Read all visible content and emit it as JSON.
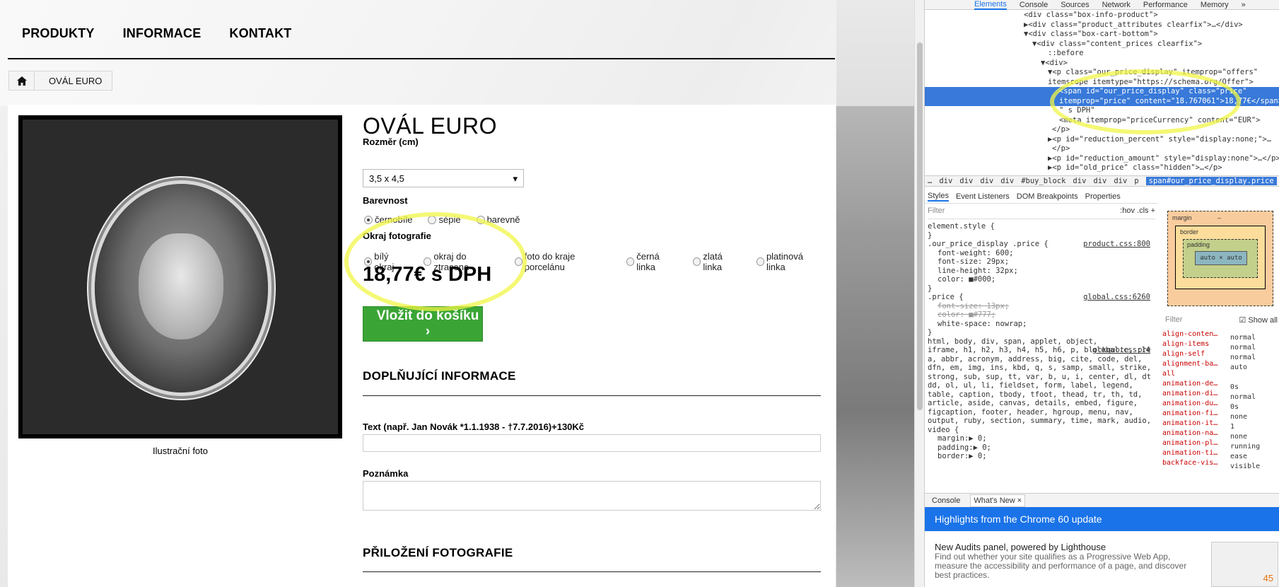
{
  "nav": {
    "items": [
      "PRODUKTY",
      "INFORMACE",
      "KONTAKT"
    ]
  },
  "breadcrumb": {
    "current": "OVÁL EURO"
  },
  "product": {
    "title": "OVÁL EURO",
    "caption": "Ilustrační foto",
    "size_label": "Rozměr (cm)",
    "size_value": "3,5 x 4,5",
    "color_label": "Barevnost",
    "color_options": [
      "černobíle",
      "sépie",
      "barevně"
    ],
    "edge_label": "Okraj fotografie",
    "edge_options": [
      "bílý okraj",
      "okraj do ztracena",
      "foto do kraje porcelánu",
      "černá linka",
      "zlatá linka",
      "platinová linka"
    ],
    "price": "18,77€ s DPH",
    "cart_button": "Vložit do košíku ›",
    "section_additional": "DOPLŇUJÍCÍ INFORMACE",
    "text_label": "Text (např. Jan Novák *1.1.1938 - †7.7.2016)+130Kč",
    "note_label": "Poznámka",
    "section_photo": "PŘILOŽENÍ FOTOGRAFIE"
  },
  "devtools": {
    "tabs": [
      "Elements",
      "Console",
      "Sources",
      "Network",
      "Performance",
      "Memory",
      "»"
    ],
    "tree": [
      "<div class=\"box-info-product\">",
      "▶<div class=\"product_attributes clearfix\">…</div>",
      "▼<div class=\"box-cart-bottom\">",
      "▼<div class=\"content_prices clearfix\">",
      "::before",
      "▼<div>",
      "▼<p class=\"our_price_display\" itemprop=\"offers\"",
      "itemscope itemtype=\"https://schema.org/Offer\">",
      "<span id=\"our_price_display\" class=\"price\"",
      "itemprop=\"price\" content=\"18.767061\">18,77€</span>",
      "\" s DPH\"",
      "<meta itemprop=\"priceCurrency\" content=\"EUR\">",
      "</p>",
      "▶<p id=\"reduction_percent\" style=\"display:none;\">…",
      "</p>",
      "▶<p id=\"reduction_amount\" style=\"display:none\">…</p>",
      "▶<p id=\"old_price\" class=\"hidden\">…</p>"
    ],
    "breadcrumb": [
      "…",
      "div",
      "div",
      "div",
      "div",
      "#buy_block",
      "div",
      "div",
      "div",
      "p"
    ],
    "breadcrumb_selected": "span#our_price_display.price",
    "style_tabs": [
      "Styles",
      "Event Listeners",
      "DOM Breakpoints",
      "Properties"
    ],
    "filter": "Filter",
    "filter_right": ":hov  .cls  +",
    "rules": [
      "element.style {",
      "}",
      ".our_price_display .price {",
      "font-weight: 600;",
      "font-size: 29px;",
      "line-height: 32px;",
      "color: ■#000;",
      "}",
      ".price {",
      "font-size: 13px;",
      "color: ■#777;",
      "white-space: nowrap;",
      "}",
      "html, body, div, span, applet, object,",
      "iframe, h1, h2, h3, h4, h5, h6, p, blockquote, pre,",
      "a, abbr, acronym, address, big, cite, code, del,",
      "dfn, em, img, ins, kbd, q, s, samp, small, strike,",
      "strong, sub, sup, tt, var, b, u, i, center, dl, dt,",
      "dd, ol, ul, li, fieldset, form, label, legend,",
      "table, caption, tbody, tfoot, thead, tr, th, td,",
      "article, aside, canvas, details, embed, figure,",
      "figcaption, footer, header, hgroup, menu, nav,",
      "output, ruby, section, summary, time, mark, audio,",
      "video {",
      "margin:▶ 0;",
      "padding:▶ 0;",
      "border:▶ 0;"
    ],
    "sources": [
      "product.css:800",
      "global.css:6260",
      "global.css:14"
    ],
    "box_model": {
      "margin": "margin",
      "border": "border",
      "padding": "padding",
      "content": "auto × auto",
      "dash": "–"
    },
    "computed_filter": "Filter",
    "show_all": "Show all",
    "computed": [
      [
        "align-conten…",
        "normal"
      ],
      [
        "align-items",
        "normal"
      ],
      [
        "align-self",
        "normal"
      ],
      [
        "alignment-ba…",
        "auto"
      ],
      [
        "all",
        ""
      ],
      [
        "animation-de…",
        "0s"
      ],
      [
        "animation-di…",
        "normal"
      ],
      [
        "animation-du…",
        "0s"
      ],
      [
        "animation-fi…",
        "none"
      ],
      [
        "animation-it…",
        "1"
      ],
      [
        "animation-na…",
        "none"
      ],
      [
        "animation-pl…",
        "running"
      ],
      [
        "animation-ti…",
        "ease"
      ],
      [
        "backface-vis…",
        "visible"
      ]
    ],
    "drawer_tabs": [
      "Console",
      "What's New ×"
    ],
    "whats_new": "Highlights from the Chrome 60 update",
    "audit_title": "New Audits panel, powered by Lighthouse",
    "audit_text": "Find out whether your site qualifies as a Progressive Web App, measure the accessibility and performance of a page, and discover best practices.",
    "score": "45"
  }
}
